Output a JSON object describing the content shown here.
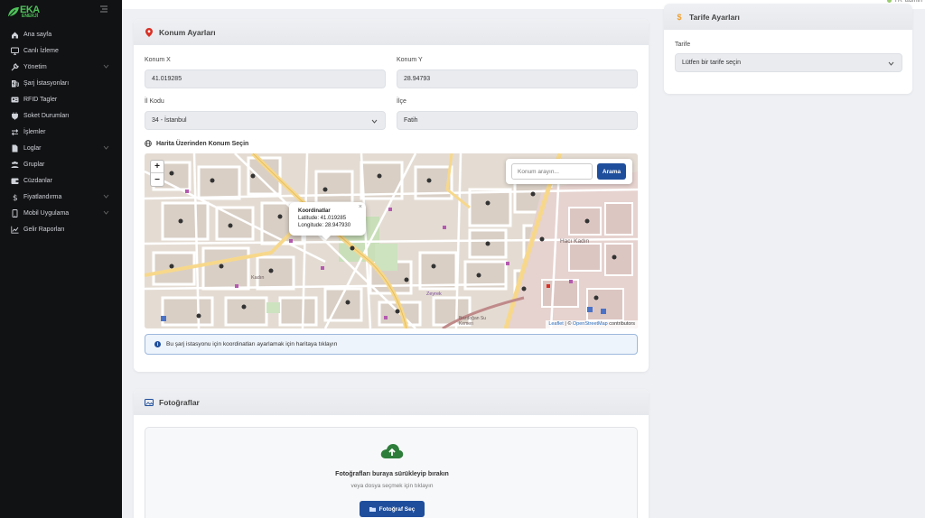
{
  "brand": {
    "name": "EKA",
    "sub": "ENERJİ"
  },
  "topbar": {
    "lang": "TR",
    "user": "admin"
  },
  "sidebar": {
    "items": [
      {
        "label": "Ana sayfa",
        "icon": "home-icon",
        "chevron": false
      },
      {
        "label": "Canlı İzleme",
        "icon": "monitor-icon",
        "chevron": false
      },
      {
        "label": "Yönetim",
        "icon": "wrench-icon",
        "chevron": true
      },
      {
        "label": "Şarj İstasyonları",
        "icon": "charging-station-icon",
        "chevron": false
      },
      {
        "label": "RFID Tagler",
        "icon": "id-card-icon",
        "chevron": false
      },
      {
        "label": "Soket Durumları",
        "icon": "plug-icon",
        "chevron": false
      },
      {
        "label": "İşlemler",
        "icon": "exchange-icon",
        "chevron": false
      },
      {
        "label": "Loglar",
        "icon": "file-icon",
        "chevron": true
      },
      {
        "label": "Gruplar",
        "icon": "users-icon",
        "chevron": false
      },
      {
        "label": "Cüzdanlar",
        "icon": "wallet-icon",
        "chevron": false
      },
      {
        "label": "Fiyatlandırma",
        "icon": "dollar-icon",
        "chevron": true
      },
      {
        "label": "Mobil Uygulama",
        "icon": "mobile-icon",
        "chevron": true
      },
      {
        "label": "Gelir Raporları",
        "icon": "chart-line-icon",
        "chevron": false
      }
    ]
  },
  "location": {
    "title": "Konum Ayarları",
    "konum_x_label": "Konum X",
    "konum_x_value": "41.019285",
    "konum_y_label": "Konum Y",
    "konum_y_value": "28.94793",
    "il_label": "İl Kodu",
    "il_value": "34 - İstanbul",
    "ilce_label": "İlçe",
    "ilce_value": "Fatih",
    "map_title": "Harita Üzerinden Konum Seçin",
    "info": "Bu şarj istasyonu için koordinatları ayarlamak için haritaya tıklayın"
  },
  "map": {
    "zoom_in": "+",
    "zoom_out": "−",
    "search_placeholder": "Konum arayın...",
    "search_button": "Arama",
    "popup_title": "Koordinatlar",
    "popup_lat": "Latitude: 41.019285",
    "popup_lng": "Longitude: 28.947930",
    "popup_close": "×",
    "attrib_leaflet": "Leaflet",
    "attrib_sep": " | © ",
    "attrib_osm": "OpenStreetMap",
    "attrib_rest": " contributors",
    "labels": [
      "Hacı Kadın",
      "Zeyrek",
      "Bozdoğan Su Kemeri",
      "Kadın"
    ]
  },
  "tariff": {
    "title": "Tarife Ayarları",
    "label": "Tarife",
    "placeholder": "Lütfen bir tarife seçin"
  },
  "photos": {
    "title": "Fotoğraflar",
    "drop_text": "Fotoğrafları buraya sürükleyip bırakın",
    "sub_text": "veya dosya seçmek için tıklayın",
    "button": "Fotoğraf Seç"
  },
  "colors": {
    "accent": "#1f4e9c",
    "brand_green": "#4fc35a",
    "pin_red": "#d93025",
    "tariff_orange": "#f0a030"
  }
}
